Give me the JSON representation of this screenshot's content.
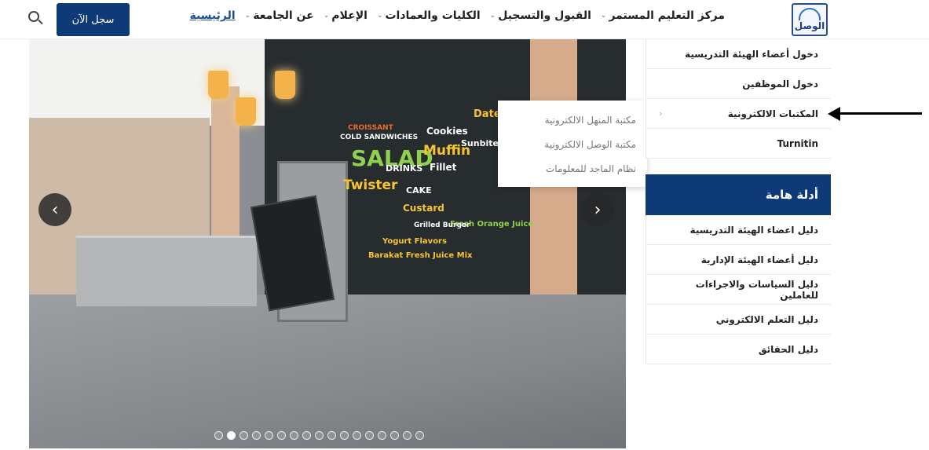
{
  "header": {
    "logo_text": "الوصل",
    "nav": [
      {
        "label": "الرئيسية",
        "active": true,
        "has_dropdown": false
      },
      {
        "label": "عن الجامعة",
        "active": false,
        "has_dropdown": true
      },
      {
        "label": "الإعلام",
        "active": false,
        "has_dropdown": true
      },
      {
        "label": "الكليات والعمادات",
        "active": false,
        "has_dropdown": true
      },
      {
        "label": "القبول والتسجيل",
        "active": false,
        "has_dropdown": true
      },
      {
        "label": "مركز التعليم المستمر",
        "active": false,
        "has_dropdown": true
      }
    ],
    "register_button": "سجل الآن",
    "search_icon": "search-icon"
  },
  "slider": {
    "prev_icon": "chevron-left-icon",
    "next_icon": "chevron-right-icon",
    "dot_count": 17,
    "active_dot": 1,
    "menu_board_words": [
      "SALAD",
      "Muffin",
      "Cookies",
      "Fillet",
      "Dates",
      "CAKE",
      "Twister",
      "Custard",
      "Sunbites",
      "Fresh Orange Juice",
      "Barakat Fresh Juice Mix",
      "Yogurt Flavors",
      "COLD SANDWICHES",
      "CROISSANT",
      "Grilled Burger",
      "DRINKS"
    ]
  },
  "submenu": {
    "items": [
      "مكتبة المنهل الالكترونية",
      "مكتبة الوصل الالكترونية",
      "نظام الماجد للمعلومات"
    ]
  },
  "sidebar": {
    "links_top": [
      {
        "label": "دخول أعضاء الهيئة التدريسية",
        "has_sub": false
      },
      {
        "label": "دخول الموظفين",
        "has_sub": false
      },
      {
        "label": "المكتبات الالكترونية",
        "has_sub": true
      },
      {
        "label": "Turnitin",
        "has_sub": false
      }
    ],
    "heading": "أدلة هامة",
    "links_guides": [
      {
        "label": "دليل اعضاء الهيئة التدريسية"
      },
      {
        "label": "دليل أعضاء الهيئة الإدارية"
      },
      {
        "label": "دليل السياسات والاجراءات للعاملين"
      },
      {
        "label": "دليل التعلم الالكتروني"
      },
      {
        "label": "دليل الحقائق"
      }
    ]
  },
  "annotation": {
    "icon": "arrow-left-icon"
  }
}
